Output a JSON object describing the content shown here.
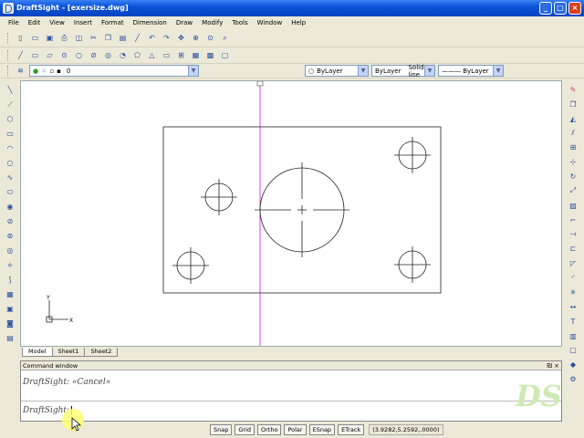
{
  "window": {
    "title": "DraftSight - [exersize.dwg]",
    "controls": [
      "_",
      "□",
      "×"
    ]
  },
  "menu": [
    "File",
    "Edit",
    "View",
    "Insert",
    "Format",
    "Dimension",
    "Draw",
    "Modify",
    "Tools",
    "Window",
    "Help"
  ],
  "layer_toolbar": {
    "layer_value": "0"
  },
  "properties_toolbar": {
    "color_value": "ByLayer",
    "linestyle_value": "ByLayer",
    "lineweight_value": "Solid line",
    "line_value": "——— ByLayer"
  },
  "icons": {
    "toolbar1": [
      "new-icon",
      "open-icon",
      "save-icon",
      "print-icon",
      "print-preview-icon",
      "cut-icon",
      "copy-icon",
      "paste-icon",
      "match-properties-icon",
      "undo-icon",
      "redo-icon",
      "pan-icon",
      "zoom-window-icon",
      "zoom-dynamic-icon",
      "zoom-icon"
    ],
    "toolbar2": [
      "move-icon",
      "copy-entity-icon",
      "mirror-icon",
      "offset-icon",
      "array-icon",
      "rotate-icon",
      "scale-icon",
      "stretch-icon",
      "trim-icon",
      "extend-icon",
      "break-icon",
      "chamfer-icon",
      "fillet-icon",
      "explode-icon",
      "erase-icon"
    ],
    "left": [
      "line-icon",
      "polyline-icon",
      "polygon-icon",
      "rectangle-icon",
      "arc-icon",
      "circle-icon",
      "spline-icon",
      "ellipse-icon",
      "point-icon",
      "hatch-icon",
      "region-icon",
      "block-icon",
      "text-icon",
      "insert-icon",
      "table-icon",
      "image-icon",
      "wipeout-icon",
      "gradient-icon"
    ],
    "right": [
      "erase-icon",
      "copy-icon",
      "mirror-icon",
      "offset-icon",
      "array-icon",
      "move-icon",
      "rotate-icon",
      "scale-icon",
      "stretch-icon",
      "trim-icon",
      "extend-icon",
      "break-icon",
      "chamfer-icon",
      "fillet-icon",
      "explode-icon",
      "dimension-icon",
      "text-icon",
      "layer-icon",
      "properties-icon",
      "help-icon",
      "settings-icon"
    ]
  },
  "tabs": [
    "Model",
    "Sheet1",
    "Sheet2"
  ],
  "command_window": {
    "title": "Command window",
    "controls": "₪ ×",
    "history": "DraftSight: «Cancel»",
    "prompt": "DraftSight:"
  },
  "logo_text": "DS",
  "status": {
    "buttons": [
      "Snap",
      "Grid",
      "Ortho",
      "Polar",
      "ESnap",
      "ETrack"
    ],
    "coordinates": "(3.9282,5.2592,.0000)"
  },
  "drawing": {
    "ucs_x": "X",
    "ucs_y": "Y"
  }
}
